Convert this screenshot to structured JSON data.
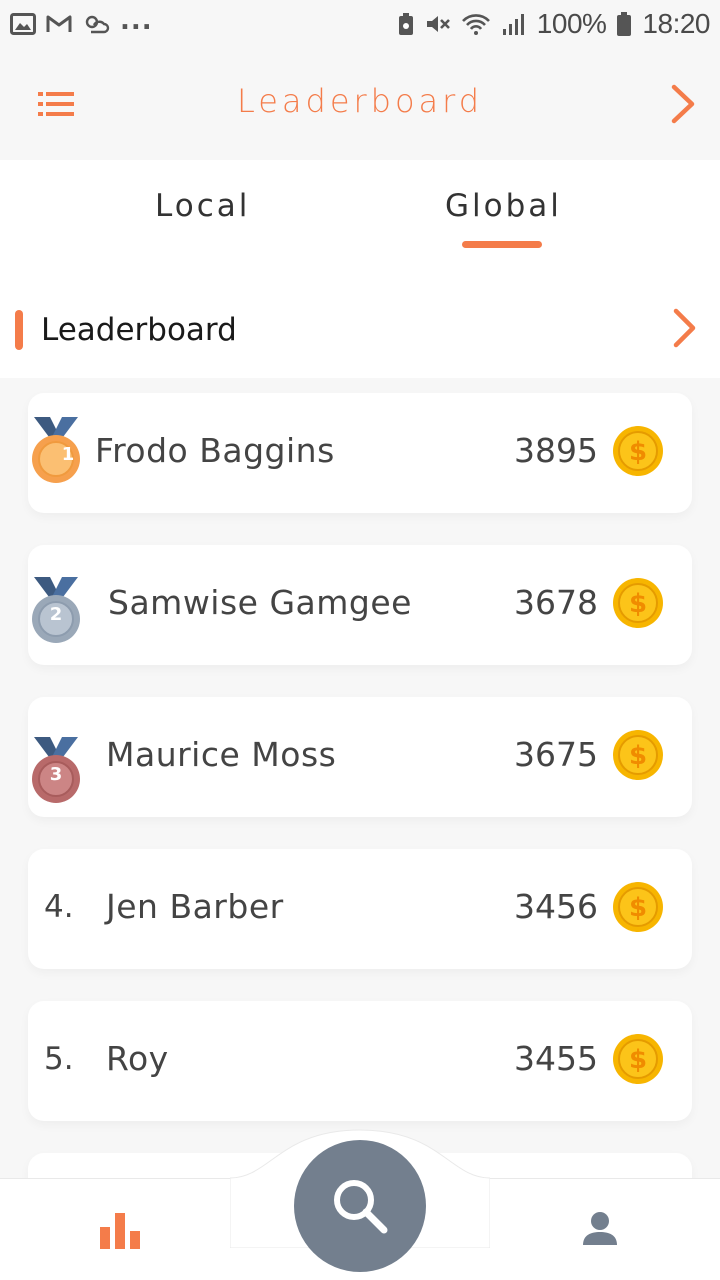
{
  "status_bar": {
    "battery": "100%",
    "time": "18:20",
    "overflow": "..."
  },
  "app_bar": {
    "title": "Leaderboard",
    "menu_icon": "hamburger-menu-icon",
    "next_icon": "chevron-right-icon"
  },
  "tabs": [
    {
      "label": "Local",
      "active": false
    },
    {
      "label": "Global",
      "active": true
    }
  ],
  "section": {
    "title": "Leaderboard",
    "next_icon": "chevron-right-icon"
  },
  "players": [
    {
      "rank": "1",
      "rank_text": "",
      "medal": "gold",
      "name": "Frodo Baggins",
      "score": "3895"
    },
    {
      "rank": "2",
      "rank_text": "",
      "medal": "silver",
      "name": "Samwise Gamgee",
      "score": "3678"
    },
    {
      "rank": "3",
      "rank_text": "",
      "medal": "bronze",
      "name": "Maurice Moss",
      "score": "3675"
    },
    {
      "rank": "4",
      "rank_text": "4.",
      "medal": "",
      "name": "Jen Barber",
      "score": "3456"
    },
    {
      "rank": "5",
      "rank_text": "5.",
      "medal": "",
      "name": "Roy",
      "score": "3455"
    }
  ],
  "bottom_nav": {
    "left_icon": "bar-chart-icon",
    "center_icon": "search-icon",
    "right_icon": "user-icon"
  },
  "colors": {
    "accent": "#f47c4a",
    "background": "#f7f7f7",
    "card": "#ffffff",
    "fab": "#737f8e",
    "text": "#444444",
    "coin": "#f7b500"
  }
}
